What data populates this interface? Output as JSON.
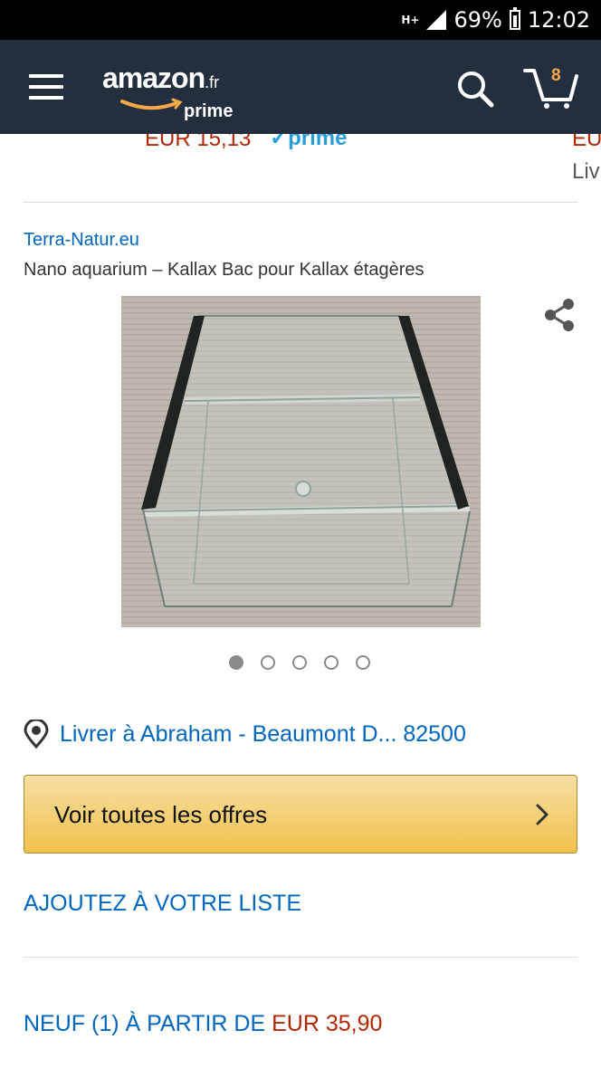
{
  "status_bar": {
    "network": "H+",
    "battery": "69%",
    "time": "12:02"
  },
  "header": {
    "logo_text": "amazon",
    "logo_tld": ".fr",
    "logo_sub": "prime",
    "cart_count": "8"
  },
  "previous_row": {
    "price": "EUR 15,13",
    "prime_label": "prime",
    "right_price": "EU",
    "right_text": "Liv"
  },
  "product": {
    "brand": "Terra-Natur.eu",
    "title": "Nano aquarium – Kallax Bac pour Kallax étagères",
    "image_icon": "glass-aquarium-image",
    "image_count": 5,
    "active_image": 1
  },
  "delivery": {
    "text": "Livrer à Abraham - Beaumont D... 82500",
    "icon": "location-pin-icon"
  },
  "offers_button": {
    "label": "Voir toutes les offres"
  },
  "add_to_list": {
    "label": "AJOUTEZ À VOTRE LISTE"
  },
  "new_offers": {
    "label": "NEUF (1) À PARTIR DE ",
    "price": "EUR 35,90"
  },
  "colors": {
    "header_bg": "#232f3e",
    "link_blue": "#0066c0",
    "price_red": "#b12704",
    "button_yellow": "#f0c14b",
    "prime_blue": "#2b9dd8",
    "cart_orange": "#f7a847"
  }
}
